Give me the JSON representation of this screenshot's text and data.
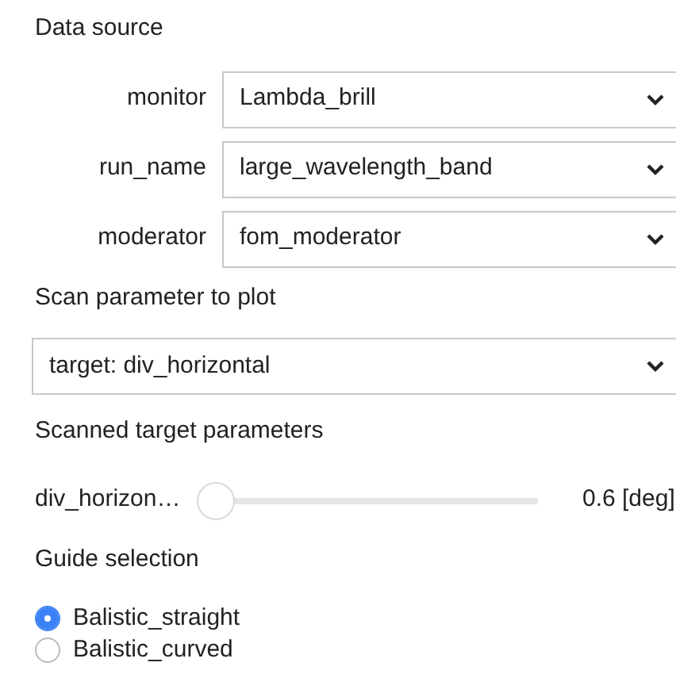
{
  "data_source": {
    "title": "Data source",
    "fields": [
      {
        "label": "monitor",
        "value": "Lambda_brill"
      },
      {
        "label": "run_name",
        "value": "large_wavelength_band"
      },
      {
        "label": "moderator",
        "value": "fom_moderator"
      }
    ]
  },
  "scan_parameter": {
    "title": "Scan parameter to plot",
    "value": "target: div_horizontal"
  },
  "scanned_parameters": {
    "title": "Scanned target parameters",
    "sliders": [
      {
        "label": "div_horizon…",
        "level": 0,
        "reading": "0.6 [deg]"
      }
    ]
  },
  "guide_selection": {
    "title": "Guide selection",
    "options": [
      {
        "label": "Balistic_straight",
        "selected": true
      },
      {
        "label": "Balistic_curved",
        "selected": false
      }
    ]
  }
}
